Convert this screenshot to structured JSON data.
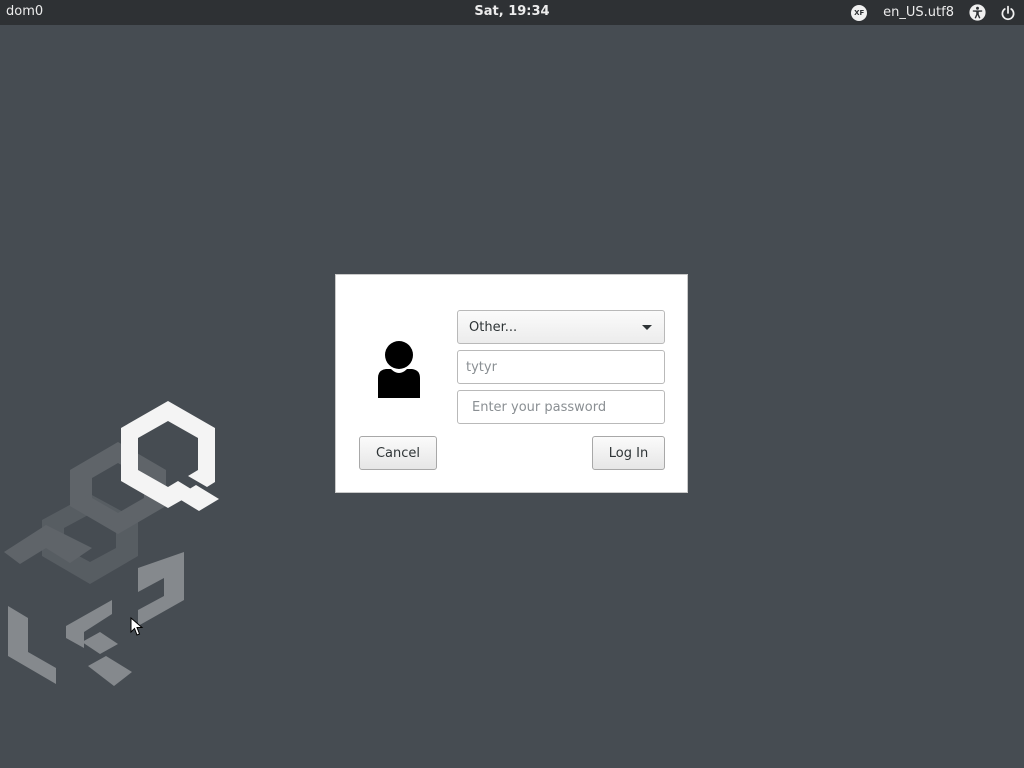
{
  "topbar": {
    "hostname": "dom0",
    "clock": "Sat, 19:34",
    "xf_icon_label": "XF",
    "locale": "en_US.utf8",
    "icons": [
      "xf-icon",
      "accessibility-icon",
      "power-icon"
    ]
  },
  "login": {
    "user_select_value": "Other...",
    "username_placeholder": "tytyr",
    "password_placeholder": "Enter your password",
    "cancel_label": "Cancel",
    "login_label": "Log In"
  },
  "colors": {
    "desktop_background": "#464c52",
    "topbar_background": "#2e3134",
    "dialog_background": "#ffffff"
  }
}
